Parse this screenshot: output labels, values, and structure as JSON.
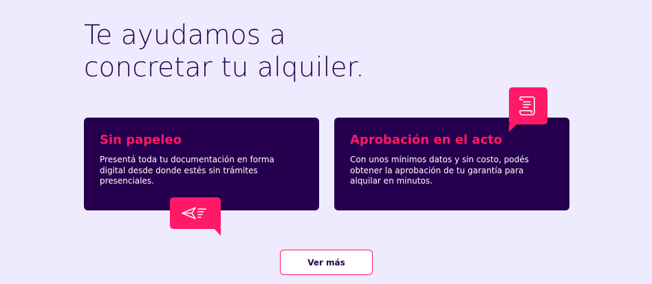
{
  "hero": {
    "title_line1": "Te ayudamos a",
    "title_line2": "concretar tu alquiler."
  },
  "features": [
    {
      "title": "Sin papeleo",
      "text": "Presentá toda tu documentación en forma digital desde donde estés sin trámites presenciales.",
      "icon": "paper-plane-icon"
    },
    {
      "title": "Aprobación en el acto",
      "text": "Con unos mínimos datos y sin costo, podés obtener la aprobación de tu garantía para alquilar en minutos.",
      "icon": "document-check-icon"
    }
  ],
  "cta": {
    "label": "Ver más"
  },
  "colors": {
    "background": "#EFEBFE",
    "primary_dark": "#26004F",
    "accent": "#FF1966",
    "white": "#FFFFFF"
  }
}
